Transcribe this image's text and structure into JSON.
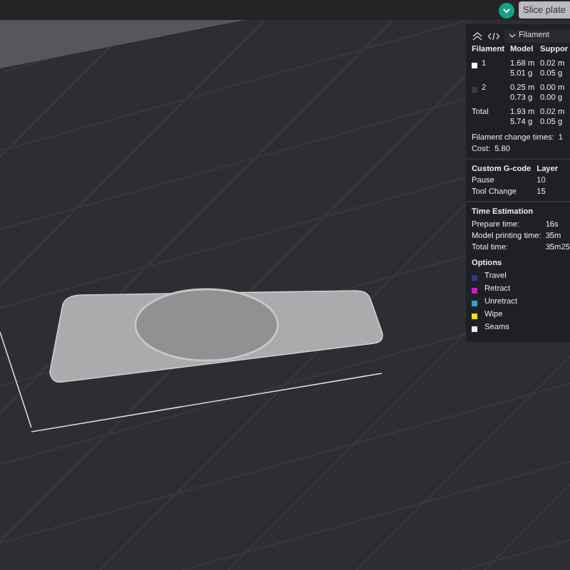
{
  "toolbar": {
    "slice_button": "Slice plate"
  },
  "panel": {
    "view": "Filament",
    "columns": [
      "Filament",
      "Model",
      "Suppor"
    ],
    "rows": [
      {
        "label": "1",
        "color": "#ffffff",
        "model": [
          "1.68 m",
          "5.01 g"
        ],
        "support": [
          "0.02 m",
          "0.05 g"
        ]
      },
      {
        "label": "2",
        "color": "#3a3b3e",
        "model": [
          "0.25 m",
          "0.73 g"
        ],
        "support": [
          "0.00 m",
          "0.00 g"
        ]
      },
      {
        "label": "Total",
        "model": [
          "1.93 m",
          "5.74 g"
        ],
        "support": [
          "0.02 m",
          "0.05 g"
        ]
      }
    ],
    "stats": [
      {
        "label": "Filament change times:",
        "value": "1"
      },
      {
        "label": "Cost:",
        "value": "5.80"
      }
    ],
    "gcode": {
      "columns": [
        "Custom G-code",
        "Layer"
      ],
      "rows": [
        [
          "Pause",
          "10"
        ],
        [
          "Tool Change",
          "15"
        ]
      ]
    },
    "time": {
      "title": "Time Estimation",
      "rows": [
        {
          "label": "Prepare time:",
          "value": "16s"
        },
        {
          "label": "Model printing time:",
          "value": "35m"
        },
        {
          "label": "Total time:",
          "value": "35m25"
        }
      ]
    },
    "options": {
      "title": "Options",
      "items": [
        {
          "label": "Travel",
          "color": "#2c3a8c"
        },
        {
          "label": "Retract",
          "color": "#c81ec8"
        },
        {
          "label": "Unretract",
          "color": "#2aa6c4"
        },
        {
          "label": "Wipe",
          "color": "#e6e020"
        },
        {
          "label": "Seams",
          "color": "#e8e8e8"
        }
      ]
    }
  }
}
